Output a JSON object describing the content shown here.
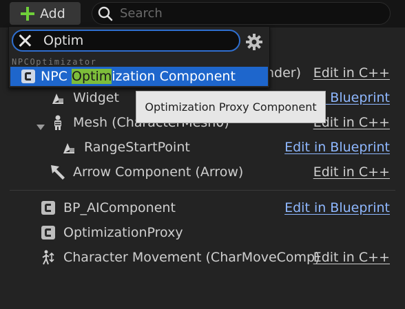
{
  "toolbar": {
    "add_label": "Add",
    "search_placeholder": "Search"
  },
  "tree": {
    "rows": [
      {
        "label": "",
        "edit": "Edit in C++"
      },
      {
        "label": "Widget",
        "edit": "Edit in Blueprint"
      },
      {
        "label": "Mesh (CharacterMesh0)",
        "edit": "Edit in C++"
      },
      {
        "label": "RangeStartPoint",
        "edit": "Edit in Blueprint"
      },
      {
        "label": "Arrow Component (Arrow)",
        "edit": "Edit in C++"
      },
      {
        "label": "BP_AIComponent",
        "edit": "Edit in Blueprint"
      },
      {
        "label": "OptimizationProxy",
        "edit": ""
      },
      {
        "label": "Character Movement (CharMoveComp)",
        "edit": "Edit in C++"
      }
    ],
    "row0_fragment": "nder)"
  },
  "dropdown": {
    "search_value": "Optim",
    "category": "NPCOptimizator",
    "item": {
      "prefix": "NPC ",
      "match": "Optim",
      "suffix": "ization Component"
    }
  },
  "tooltip": "Optimization Proxy Component",
  "colors": {
    "accent": "#1e66cc",
    "link": "#8fb8ff",
    "match": "#7dbd3a",
    "add": "#6fcf3a"
  }
}
